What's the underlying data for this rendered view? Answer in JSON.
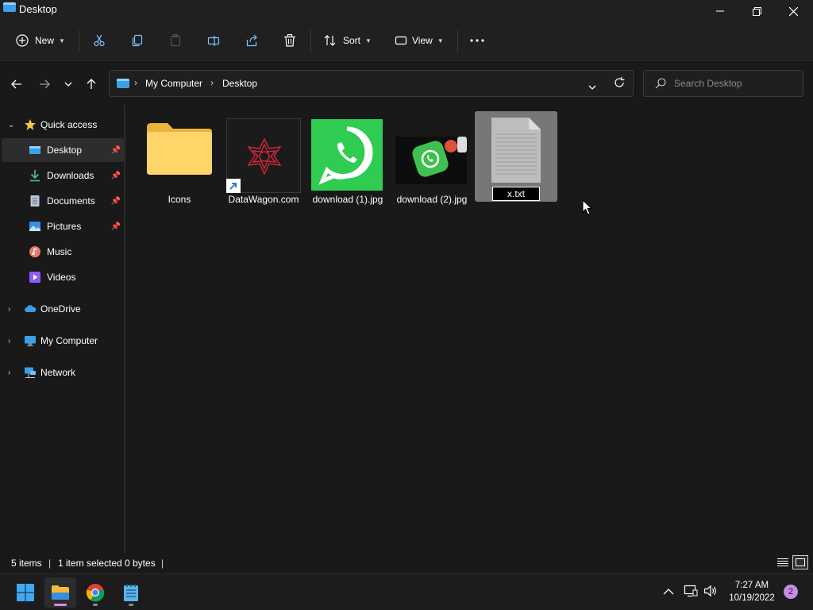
{
  "window": {
    "title": "Desktop"
  },
  "toolbar": {
    "new_label": "New",
    "sort_label": "Sort",
    "view_label": "View"
  },
  "address": {
    "crumbs": [
      "My Computer",
      "Desktop"
    ]
  },
  "search": {
    "placeholder": "Search Desktop"
  },
  "sidebar": {
    "quick_access": "Quick access",
    "items": [
      {
        "label": "Desktop",
        "pinned": true,
        "icon": "desktop-icon"
      },
      {
        "label": "Downloads",
        "pinned": true,
        "icon": "download-icon"
      },
      {
        "label": "Documents",
        "pinned": true,
        "icon": "document-icon"
      },
      {
        "label": "Pictures",
        "pinned": true,
        "icon": "pictures-icon"
      },
      {
        "label": "Music",
        "pinned": false,
        "icon": "music-icon"
      },
      {
        "label": "Videos",
        "pinned": false,
        "icon": "videos-icon"
      }
    ],
    "onedrive": "OneDrive",
    "my_computer": "My Computer",
    "network": "Network"
  },
  "files": [
    {
      "name": "Icons",
      "type": "folder"
    },
    {
      "name": "DataWagon.com",
      "type": "shortcut"
    },
    {
      "name": "download (1).jpg",
      "type": "image"
    },
    {
      "name": "download (2).jpg",
      "type": "image"
    },
    {
      "name": "x.txt",
      "type": "text",
      "renaming": true
    }
  ],
  "status": {
    "items": "5 items",
    "selected": "1 item selected",
    "size": "0 bytes"
  },
  "taskbar": {
    "time": "7:27 AM",
    "date": "10/19/2022",
    "notifications": "2"
  },
  "colors": {
    "accent": "#3aa0e8",
    "selected_item": "#777777",
    "notification_badge": "#c88be6"
  }
}
